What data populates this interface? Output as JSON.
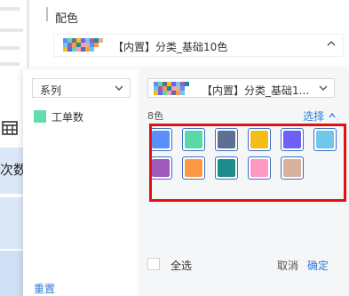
{
  "background": {
    "left_text": "次数"
  },
  "config": {
    "section_title": "配色",
    "current_scheme_label": "【内置】分类_基础10色"
  },
  "panel": {
    "series_select_label": "系列",
    "series_items": [
      {
        "label": "工单数",
        "color": "#63ddb0"
      }
    ],
    "palette_select_label": "【内置】分类_基础1...",
    "count_label": "8色",
    "select_link": "选择",
    "reset_label": "重置",
    "select_all_label": "全选",
    "cancel_label": "取消",
    "ok_label": "确定",
    "palette_colors": [
      "#5b8ff9",
      "#5ad8a6",
      "#5d7092",
      "#f6bd16",
      "#6e5ff7",
      "#6dc8ec",
      "#9f5cbe",
      "#ff9845",
      "#1e8c8a",
      "#ff99c3",
      "#d9b29e"
    ]
  },
  "colors": {
    "accent": "#2f7ad8",
    "highlight_box": "#e0120f"
  }
}
